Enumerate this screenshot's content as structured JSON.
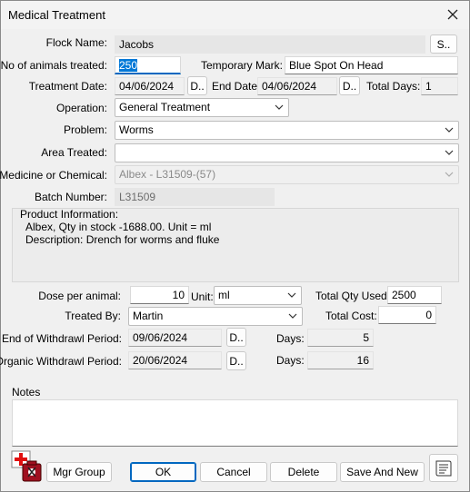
{
  "window": {
    "title": "Medical Treatment",
    "close_icon": "close-icon"
  },
  "flock": {
    "label": "Flock Name:",
    "value": "Jacobs",
    "search_button": "S.."
  },
  "animals": {
    "label": "No of animals treated:",
    "value": "250"
  },
  "temp_mark": {
    "label": "Temporary Mark:",
    "value": "Blue Spot On Head"
  },
  "treatment_date": {
    "label": "Treatment Date:",
    "value": "04/06/2024",
    "picker": "D.."
  },
  "end_date": {
    "label": "End Date:",
    "value": "04/06/2024",
    "picker": "D.."
  },
  "total_days": {
    "label": "Total Days:",
    "value": "1"
  },
  "operation": {
    "label": "Operation:",
    "value": "General Treatment"
  },
  "problem": {
    "label": "Problem:",
    "value": "Worms"
  },
  "area_treated": {
    "label": "Area Treated:",
    "value": ""
  },
  "medicine": {
    "label": "Medicine or Chemical:",
    "value": "Albex - L31509-(57)"
  },
  "batch": {
    "label": "Batch Number:",
    "value": "L31509"
  },
  "product_info": {
    "label": "Product Information:",
    "line1": "Albex, Qty in stock -1688.00. Unit = ml",
    "line2": "Description: Drench for worms and fluke"
  },
  "dose": {
    "label": "Dose per animal:",
    "value": "10",
    "unit_label": "Unit:",
    "unit_value": "ml"
  },
  "total_qty": {
    "label": "Total Qty Used:",
    "value": "2500"
  },
  "treated_by": {
    "label": "Treated By:",
    "value": "Martin"
  },
  "total_cost": {
    "label": "Total Cost:",
    "value": "0"
  },
  "withdrawal": {
    "label": "End of Withdrawl Period:",
    "value": "09/06/2024",
    "picker": "D..",
    "days_label": "Days:",
    "days": "5"
  },
  "organic_withdrawal": {
    "label": "Organic Withdrawl Period:",
    "value": "20/06/2024",
    "picker": "D..",
    "days_label": "Days:",
    "days": "16"
  },
  "notes": {
    "label": "Notes",
    "value": ""
  },
  "buttons": {
    "mgr_group": "Mgr Group",
    "ok": "OK",
    "cancel": "Cancel",
    "delete": "Delete",
    "save_new": "Save And New"
  },
  "icons": {
    "medical": "medical-kit-icon",
    "report": "report-icon"
  }
}
